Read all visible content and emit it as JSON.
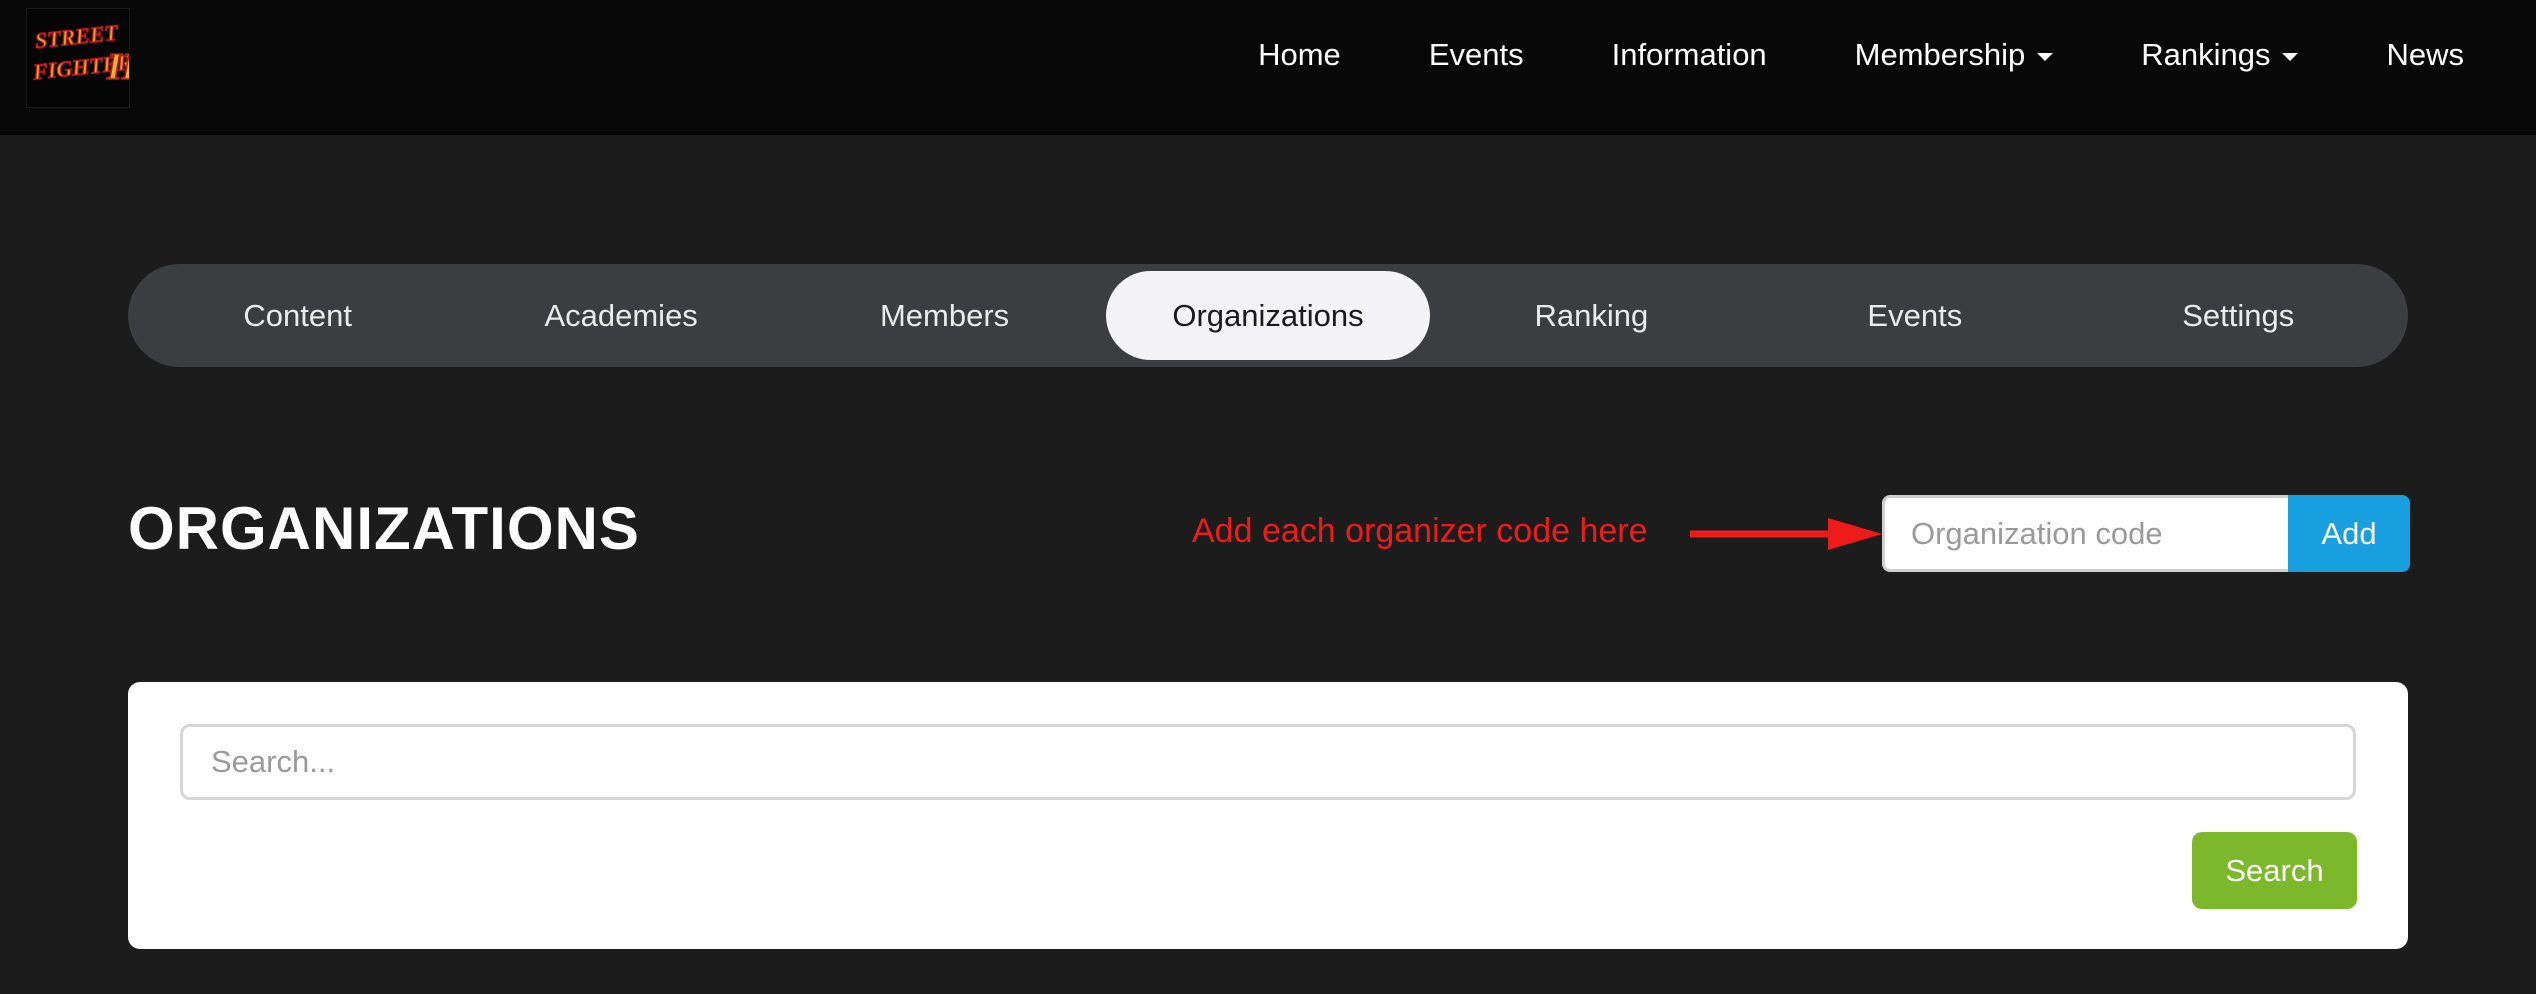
{
  "logo": {
    "alt": "Street Fighter II"
  },
  "nav": {
    "items": [
      {
        "label": "Home",
        "dropdown": false
      },
      {
        "label": "Events",
        "dropdown": false
      },
      {
        "label": "Information",
        "dropdown": false
      },
      {
        "label": "Membership",
        "dropdown": true
      },
      {
        "label": "Rankings",
        "dropdown": true
      },
      {
        "label": "News",
        "dropdown": false
      }
    ]
  },
  "tabs": {
    "items": [
      {
        "label": "Content"
      },
      {
        "label": "Academies"
      },
      {
        "label": "Members"
      },
      {
        "label": "Organizations"
      },
      {
        "label": "Ranking"
      },
      {
        "label": "Events"
      },
      {
        "label": "Settings"
      }
    ],
    "active": "Organizations"
  },
  "page": {
    "title": "ORGANIZATIONS"
  },
  "annotation": {
    "text": "Add each organizer code here",
    "color": "#ee1b1b"
  },
  "add_form": {
    "placeholder": "Organization code",
    "value": "",
    "button_label": "Add"
  },
  "search": {
    "placeholder": "Search...",
    "value": "",
    "button_label": "Search"
  },
  "colors": {
    "page_bg": "#1c1c1d",
    "navbar_bg": "#080808",
    "tabs_bg": "#3c3d41",
    "active_tab_bg": "#f4f4f7",
    "add_button": "#179fe0",
    "search_button": "#7cb82c"
  }
}
